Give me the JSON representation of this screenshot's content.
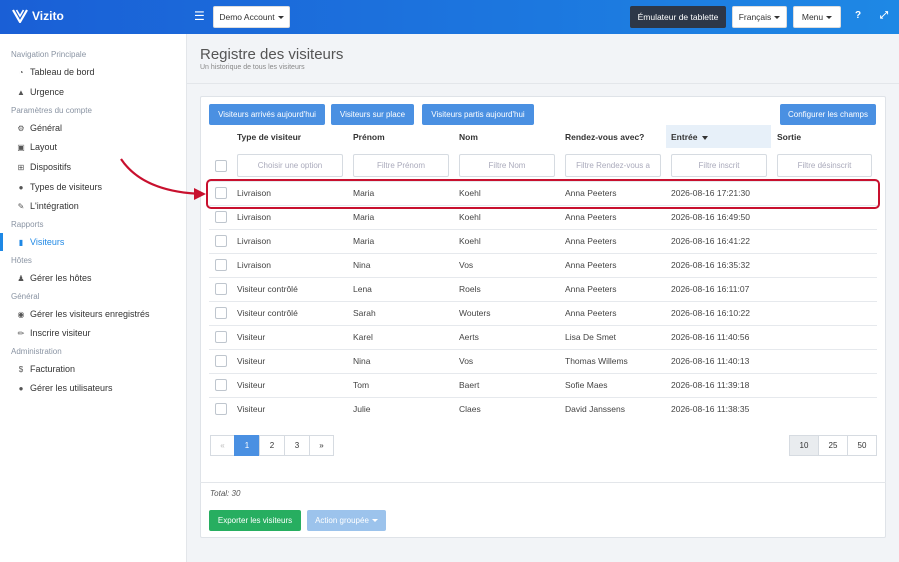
{
  "header": {
    "brand": "Vizito",
    "account": "Demo Account",
    "tablet": "Émulateur de tablette",
    "language": "Français",
    "menu": "Menu",
    "help": "?",
    "expand": "⤢"
  },
  "sidebar": {
    "sections": {
      "main": "Navigation Principale",
      "settings": "Paramètres du compte",
      "reports": "Rapports",
      "hosts": "Hôtes",
      "general": "Général",
      "admin": "Administration"
    },
    "items": {
      "dashboard": "Tableau de bord",
      "emergency": "Urgence",
      "general": "Général",
      "layout": "Layout",
      "devices": "Dispositifs",
      "visitor_types": "Types de visiteurs",
      "integration": "L'intégration",
      "visitors": "Visiteurs",
      "manage_hosts": "Gérer les hôtes",
      "manage_registered": "Gérer les visiteurs enregistrés",
      "register_visitor": "Inscrire visiteur",
      "billing": "Facturation",
      "manage_users": "Gérer les utilisateurs"
    }
  },
  "page": {
    "title": "Registre des visiteurs",
    "subtitle": "Un historique de tous les visiteurs"
  },
  "toolbar": {
    "arrived_today": "Visiteurs arrivés aujourd'hui",
    "on_site": "Visiteurs sur place",
    "left_today": "Visiteurs partis aujourd'hui",
    "configure": "Configurer les champs"
  },
  "table": {
    "headers": {
      "type": "Type de visiteur",
      "first": "Prénom",
      "last": "Nom",
      "meeting": "Rendez-vous avec?",
      "entry": "Entrée",
      "exit": "Sortie"
    },
    "filters": {
      "type": "Choisir une option",
      "first": "Filtre Prénom",
      "last": "Filtre Nom",
      "meeting": "Filtre Rendez-vous a",
      "entry": "Filtre inscrit",
      "exit": "Filtre désinscrit"
    },
    "rows": [
      {
        "type": "Livraison",
        "first": "Maria",
        "last": "Koehl",
        "meeting": "Anna Peeters",
        "entry": "2026-08-16 17:21:30",
        "exit": ""
      },
      {
        "type": "Livraison",
        "first": "Maria",
        "last": "Koehl",
        "meeting": "Anna Peeters",
        "entry": "2026-08-16 16:49:50",
        "exit": ""
      },
      {
        "type": "Livraison",
        "first": "Maria",
        "last": "Koehl",
        "meeting": "Anna Peeters",
        "entry": "2026-08-16 16:41:22",
        "exit": ""
      },
      {
        "type": "Livraison",
        "first": "Nina",
        "last": "Vos",
        "meeting": "Anna Peeters",
        "entry": "2026-08-16 16:35:32",
        "exit": ""
      },
      {
        "type": "Visiteur contrôlé",
        "first": "Lena",
        "last": "Roels",
        "meeting": "Anna Peeters",
        "entry": "2026-08-16 16:11:07",
        "exit": ""
      },
      {
        "type": "Visiteur contrôlé",
        "first": "Sarah",
        "last": "Wouters",
        "meeting": "Anna Peeters",
        "entry": "2026-08-16 16:10:22",
        "exit": ""
      },
      {
        "type": "Visiteur",
        "first": "Karel",
        "last": "Aerts",
        "meeting": "Lisa De Smet",
        "entry": "2026-08-16 11:40:56",
        "exit": ""
      },
      {
        "type": "Visiteur",
        "first": "Nina",
        "last": "Vos",
        "meeting": "Thomas Willems",
        "entry": "2026-08-16 11:40:13",
        "exit": ""
      },
      {
        "type": "Visiteur",
        "first": "Tom",
        "last": "Baert",
        "meeting": "Sofie Maes",
        "entry": "2026-08-16 11:39:18",
        "exit": ""
      },
      {
        "type": "Visiteur",
        "first": "Julie",
        "last": "Claes",
        "meeting": "David Janssens",
        "entry": "2026-08-16 11:38:35",
        "exit": ""
      }
    ]
  },
  "pagination": {
    "prev": "«",
    "pages": [
      "1",
      "2",
      "3"
    ],
    "next": "»",
    "sizes": [
      "10",
      "25",
      "50"
    ]
  },
  "footer": {
    "total": "Total: 30",
    "export": "Exporter les visiteurs",
    "bulk": "Action groupée"
  },
  "colors": {
    "primary": "#1e88e5",
    "button": "#4a90e2",
    "success": "#27ae60",
    "highlight": "#c8102e"
  }
}
